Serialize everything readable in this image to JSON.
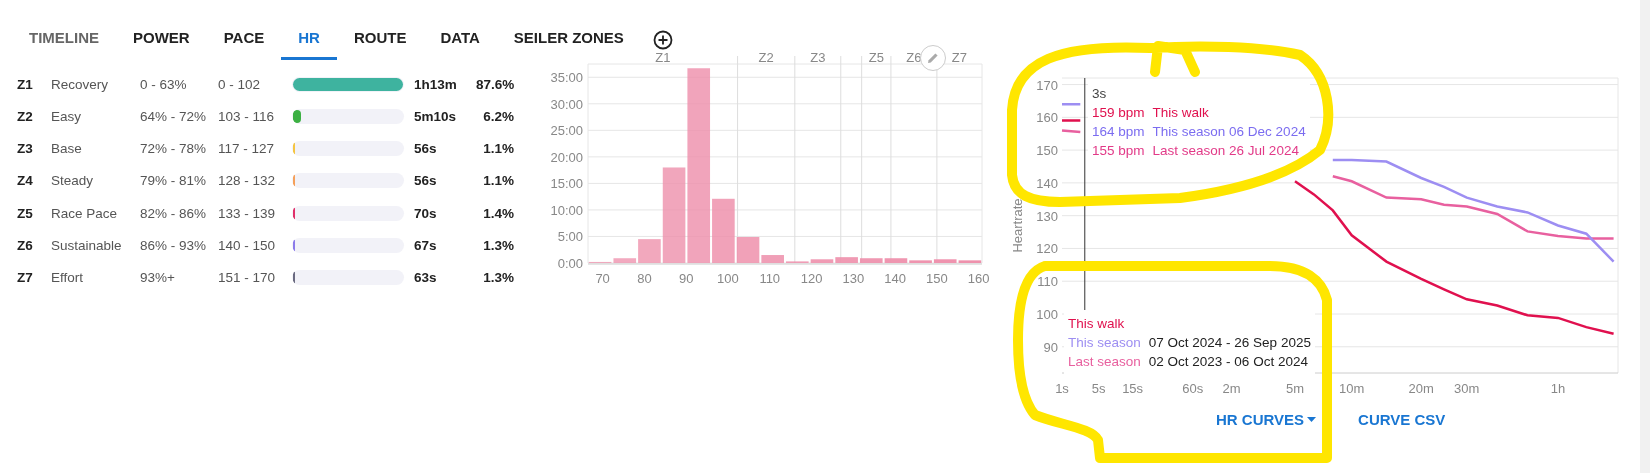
{
  "tabs": [
    {
      "label": "TIMELINE",
      "selected": false,
      "disabled": true
    },
    {
      "label": "POWER",
      "selected": false,
      "disabled": false
    },
    {
      "label": "PACE",
      "selected": false,
      "disabled": false
    },
    {
      "label": "HR",
      "selected": true,
      "disabled": false
    },
    {
      "label": "ROUTE",
      "selected": false,
      "disabled": false
    },
    {
      "label": "DATA",
      "selected": false,
      "disabled": false
    },
    {
      "label": "SEILER ZONES",
      "selected": false,
      "disabled": false
    }
  ],
  "zones": [
    {
      "zone": "Z1",
      "name": "Recovery",
      "pct": "0 - 63%",
      "bpm": "0 - 102",
      "level": 1,
      "time": "1h13m",
      "percent": "87.6%",
      "color": "#3eb39f"
    },
    {
      "zone": "Z2",
      "name": "Easy",
      "pct": "64% - 72%",
      "bpm": "103 - 116",
      "level": 0.07,
      "time": "5m10s",
      "percent": "6.2%",
      "color": "#3cb043"
    },
    {
      "zone": "Z3",
      "name": "Base",
      "pct": "72% - 78%",
      "bpm": "117 - 127",
      "level": 0.012,
      "time": "56s",
      "percent": "1.1%",
      "color": "#f5c542"
    },
    {
      "zone": "Z4",
      "name": "Steady",
      "pct": "79% - 81%",
      "bpm": "128 - 132",
      "level": 0.012,
      "time": "56s",
      "percent": "1.1%",
      "color": "#f5a05a"
    },
    {
      "zone": "Z5",
      "name": "Race Pace",
      "pct": "82% - 86%",
      "bpm": "133 - 139",
      "level": 0.016,
      "time": "70s",
      "percent": "1.4%",
      "color": "#e0306a"
    },
    {
      "zone": "Z6",
      "name": "Sustainable",
      "pct": "86% - 93%",
      "bpm": "140 - 150",
      "level": 0.015,
      "time": "67s",
      "percent": "1.3%",
      "color": "#8c7bea"
    },
    {
      "zone": "Z7",
      "name": "Effort",
      "pct": "93%+",
      "bpm": "151 - 170",
      "level": 0.015,
      "time": "63s",
      "percent": "1.3%",
      "color": "#6a6a80"
    }
  ],
  "histogram": {
    "zone_marks": [
      {
        "kind": "labeled",
        "label": "Z1"
      },
      {
        "kind": "labeled",
        "label": "Z2"
      },
      {
        "kind": "labeled",
        "label": "Z3"
      },
      {
        "kind": "unlabeled"
      },
      {
        "kind": "labeled",
        "label": "Z5"
      },
      {
        "kind": "labeled",
        "label": "Z6"
      },
      {
        "kind": "labeled",
        "label": "Z7"
      }
    ],
    "chart_data": {
      "type": "bar",
      "grid": true,
      "x": [
        69.4,
        75.3,
        81.2,
        87.1,
        93,
        98.9,
        104.8,
        110.7,
        116.6,
        122.5,
        128.4,
        134.3,
        140.2,
        146.1,
        152,
        157.9
      ],
      "series": [
        {
          "color": "#ee8fab",
          "values": [
            0.2,
            0.9,
            4.5,
            18,
            36.7,
            12.1,
            4.9,
            1.5,
            0.3,
            0.7,
            1.1,
            0.9,
            0.9,
            0.5,
            0.7,
            0.5
          ]
        }
      ],
      "xlim": [
        66.5,
        160.8
      ],
      "ylim": [
        0,
        37.5
      ],
      "xticks": [
        70,
        80,
        90,
        100,
        110,
        120,
        130,
        140,
        150,
        160
      ],
      "yticks": [
        {
          "value": 0,
          "label": "0:00"
        },
        {
          "value": 5,
          "label": "5:00"
        },
        {
          "value": 10,
          "label": "10:00"
        },
        {
          "value": 15,
          "label": "15:00"
        },
        {
          "value": 20,
          "label": "20:00"
        },
        {
          "value": 25,
          "label": "25:00"
        },
        {
          "value": 30,
          "label": "30:00"
        },
        {
          "value": 35,
          "label": "35:00"
        }
      ]
    }
  },
  "curves": {
    "chart_data": {
      "type": "line",
      "ylabel": "Heartrate",
      "grid": true,
      "categories": [
        "1s",
        null,
        "5s",
        "15s",
        "60s",
        "2m",
        null,
        null,
        "5m",
        null,
        null,
        "10m",
        null,
        "20m",
        null,
        "30m",
        null,
        null,
        "1h",
        null,
        null
      ],
      "series": [
        {
          "name": "This walk",
          "color": "#e0104e",
          "values": [
            159,
            159,
            null,
            null,
            null,
            null,
            null,
            null,
            140.5,
            136.5,
            131.6,
            124,
            116,
            110.7,
            107.5,
            104.5,
            102.6,
            99.6,
            98.8,
            96,
            94
          ]
        },
        {
          "name": "This season",
          "color": "#9d8ef2",
          "values": [
            164,
            164,
            null,
            null,
            null,
            null,
            null,
            null,
            null,
            null,
            147,
            147,
            146.5,
            141.5,
            138.8,
            135.5,
            132.8,
            131,
            127,
            124.5,
            116
          ]
        },
        {
          "name": "Last season",
          "color": "#e8609f",
          "values": [
            156,
            155.5,
            null,
            null,
            null,
            null,
            null,
            null,
            null,
            null,
            142,
            140.5,
            135.5,
            135,
            133.3,
            132.8,
            130.5,
            125.2,
            123.8,
            123,
            123
          ]
        }
      ],
      "ylim": [
        82,
        172
      ],
      "yticks": [
        90,
        100,
        110,
        120,
        130,
        140,
        150,
        160,
        170
      ]
    },
    "tooltip": {
      "time": "3s",
      "rows": [
        {
          "bpm": "159 bpm",
          "series": "This walk",
          "color": "#e0104e"
        },
        {
          "bpm": "164 bpm",
          "series": "This season 06 Dec 2024",
          "color": "#7b6cf0"
        },
        {
          "bpm": "155 bpm",
          "series": "Last season 26 Jul 2024",
          "color": "#e23a88"
        }
      ]
    },
    "legend_ranges": [
      "07 Oct 2024 - 26 Sep 2025",
      "02 Oct 2023 - 06 Oct 2024"
    ],
    "buttons": [
      {
        "label": "HR CURVES",
        "kind": "dropdown"
      },
      {
        "label": "CURVE CSV",
        "kind": "plain"
      }
    ]
  }
}
